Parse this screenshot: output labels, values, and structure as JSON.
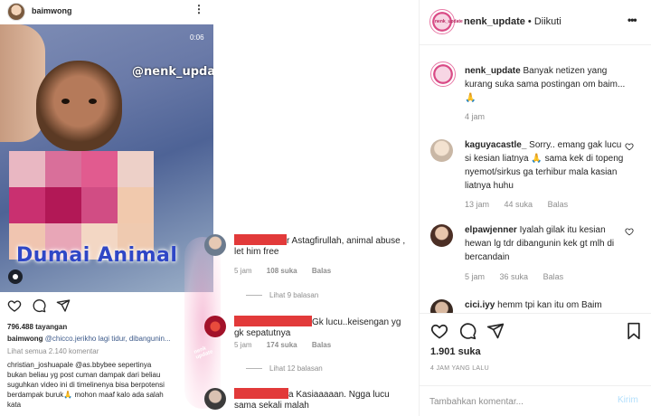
{
  "left_post": {
    "username": "baimwong",
    "video": {
      "time": "0:06",
      "watermark": "@nenk_update",
      "caption": "Dumai Animal"
    },
    "views": "796.488 tayangan",
    "caption_user": "baimwong",
    "caption_text": "@chicco.jerikho lagi tidur, dibangunin...",
    "view_all_comments": "Lihat semua 2.140 komentar",
    "comment": {
      "user": "christian_joshuapale",
      "mention": "@as.bbybee",
      "lines": [
        "christian_joshuapale @as.bbybee sepertinya",
        "bukan beliau yg post cuman dampak dari beliau",
        "suguhkan video ini di timelinenya bisa berpotensi",
        "berdampak buruk🙏 mohon maaf kalo ada salah",
        "kata"
      ]
    }
  },
  "pink_mark_text": "nenk update",
  "mid_comments": [
    {
      "text": "r Astagfirullah, animal abuse , let him free",
      "time": "5 jam",
      "likes": "108 suka",
      "reply": "Balas",
      "more_replies": "Lihat 9 balasan"
    },
    {
      "text": "Gk lucu..keisengan yg gk sepatutnya",
      "time": "5 jam",
      "likes": "174 suka",
      "reply": "Balas",
      "more_replies": "Lihat 12 balasan"
    },
    {
      "text": "a Kasiaaaaan. Ngga lucu sama sekali malah"
    }
  ],
  "right_post": {
    "account": "nenk_update",
    "follow_status": "• Diikuti",
    "caption": {
      "user": "nenk_update",
      "text": "Banyak netizen yang kurang suka sama postingan om baim... 🙏",
      "time": "4 jam"
    },
    "comments": [
      {
        "user": "kaguyacastle_",
        "text": "Sorry.. emang gak lucu si kesian liatnya 🙏 sama kek di topeng nyemot/sirkus ga terhibur mala kasian liatnya huhu",
        "time": "13 jam",
        "likes": "44 suka",
        "reply": "Balas"
      },
      {
        "user": "elpawjenner",
        "text": "Iyalah gilak itu kesian hewan lg tdr dibangunin kek gt mlh di bercandain",
        "time": "5 jam",
        "likes": "36 suka",
        "reply": "Balas"
      },
      {
        "user": "cici.iyy",
        "text": "hemm tpi kan itu om Baim"
      }
    ],
    "likes": "1.901 suka",
    "posted": "4 JAM YANG LALU",
    "input_placeholder": "Tambahkan komentar...",
    "send_label": "Kirim"
  },
  "colors": {
    "text": "#262626",
    "muted": "#8e8e8e",
    "link": "#3d5a8a",
    "redact": "#e23a3a",
    "send_disabled": "#b2dffc",
    "caption_blue": "#2f47c6"
  }
}
